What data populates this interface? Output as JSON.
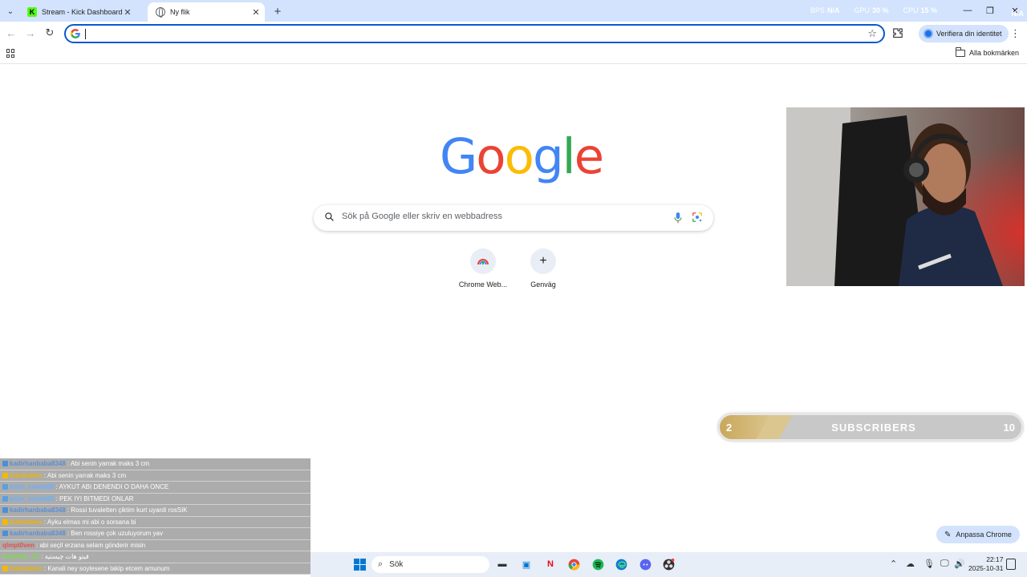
{
  "browser": {
    "tabs": [
      {
        "title": "Stream - Kick Dashboard",
        "active": false,
        "favicon": "kick-icon"
      },
      {
        "title": "Ny flik",
        "active": true,
        "favicon": "globe-icon"
      }
    ],
    "overlay_stats": {
      "bps_label": "BPS",
      "bps_value": "N/A",
      "gpu_label": "GPU",
      "gpu_value": "30 %",
      "cpu_label": "CPU",
      "cpu_value": "15 %",
      "extra_value": "N/A"
    },
    "omnibox": {
      "value": "",
      "placeholder": ""
    },
    "verify_label": "Verifiera din identitet",
    "all_bookmarks_label": "Alla bokmärken"
  },
  "ntp": {
    "logo_letters": [
      "G",
      "o",
      "o",
      "g",
      "l",
      "e"
    ],
    "search_placeholder": "Sök på Google eller skriv en webbadress",
    "shortcuts": [
      {
        "label": "Chrome Web...",
        "icon": "chrome-web-store-icon"
      },
      {
        "label": "Genväg",
        "icon": "plus-icon"
      }
    ],
    "customize_label": "Anpassa Chrome"
  },
  "stream_overlay": {
    "subscribers": {
      "current": "2",
      "label": "SUBSCRIBERS",
      "goal": "10",
      "progress": 0.2
    },
    "chat": [
      {
        "user": "kadirhanbaba8348",
        "message": ": Abi senin yarrak maks 3 cm",
        "badge_color": "#4a90d9",
        "user_color": "#5b8fd6"
      },
      {
        "user": "fukoloders",
        "message": ": Abi senin yarrak maks 3 cm",
        "badge_color": "#f5b800",
        "user_color": "#f0b400"
      },
      {
        "user": "ictim_sarabi00",
        "message": ": AYKUT ABI DENENDI O DAHA ONCE",
        "badge_color": "#5aa0e0",
        "user_color": "#66b0ff"
      },
      {
        "user": "ictim_sarabi00",
        "message": ": PEK IYI BITMEDI ONLAR",
        "badge_color": "#5aa0e0",
        "user_color": "#66b0ff"
      },
      {
        "user": "kadirhanbaba8348",
        "message": ": Rossi tuvaletten çiktim kurt uyardi rosSIK",
        "badge_color": "#4a90d9",
        "user_color": "#5b8fd6"
      },
      {
        "user": "fukoloders",
        "message": ": Ayku elmas mi abi o sorsana bi",
        "badge_color": "#f5b800",
        "user_color": "#f0b400"
      },
      {
        "user": "kadirhanbaba8348",
        "message": ": Ben rossiye çok uzuluyorum yav",
        "badge_color": "#4a90d9",
        "user_color": "#5b8fd6"
      },
      {
        "user": "qlmpt0ven",
        "message": ": abi seçil erzana selam gönderir misin",
        "badge_color": "",
        "user_color": "#e05050"
      },
      {
        "user": "GabRieL_21",
        "message": ": قيتو هات چيستية",
        "badge_color": "",
        "user_color": "#7ddc4a"
      },
      {
        "user": "fukoloders",
        "message": ": Kanali ney soylesene takip etcem amunum",
        "badge_color": "#f5b800",
        "user_color": "#f0b400"
      }
    ]
  },
  "taskbar": {
    "search_label": "Sök",
    "time": "22:17",
    "date": "2025-10-31",
    "apps": [
      "file-explorer-icon",
      "store-icon",
      "netflix-icon",
      "chrome-icon",
      "spotify-icon",
      "edge-icon",
      "discord-icon",
      "obs-icon"
    ]
  }
}
